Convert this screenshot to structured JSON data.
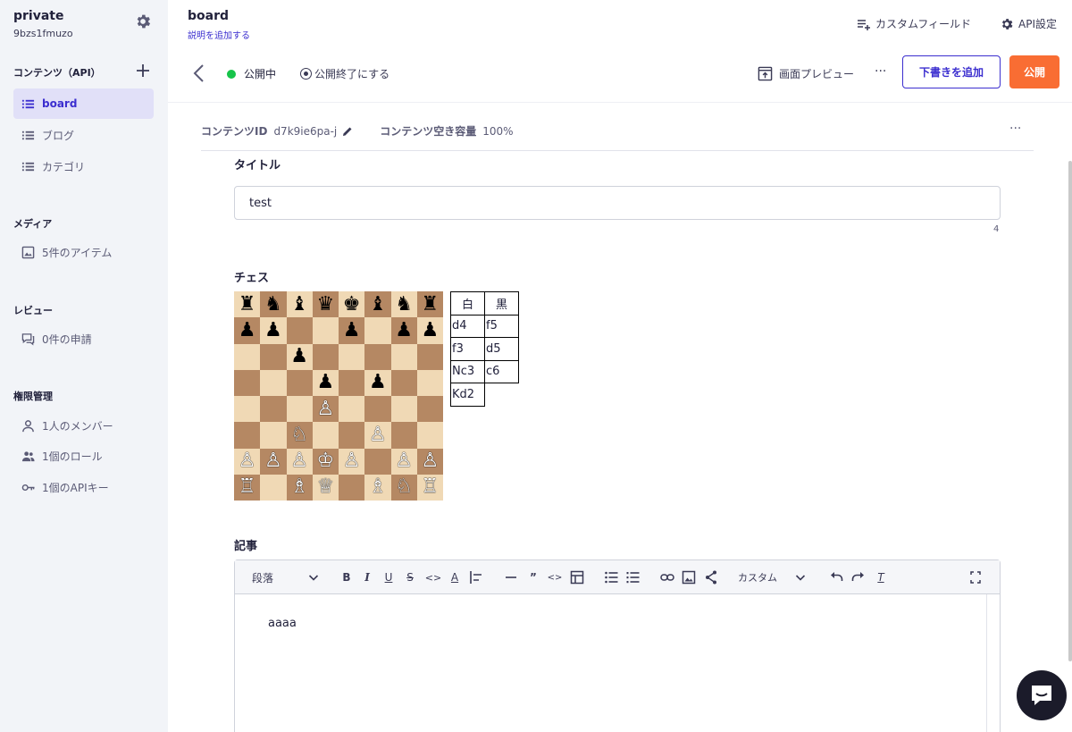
{
  "sidebar": {
    "service_name": "private",
    "service_id": "9bzs1fmuzo",
    "contents_header": "コンテンツ（API）",
    "contents": [
      {
        "label": "board",
        "active": true
      },
      {
        "label": "ブログ",
        "active": false
      },
      {
        "label": "カテゴリ",
        "active": false
      }
    ],
    "media_header": "メディア",
    "media_item": "5件のアイテム",
    "review_header": "レビュー",
    "review_item": "0件の申請",
    "perm_header": "権限管理",
    "perm_items": [
      "1人のメンバー",
      "1個のロール",
      "1個のAPIキー"
    ]
  },
  "header": {
    "title": "board",
    "subtitle": "説明を追加する",
    "custom_field": "カスタムフィールド",
    "api_settings": "API設定"
  },
  "actions": {
    "status": "公開中",
    "status_color": "#17c44a",
    "unpublish": "公開終了にする",
    "preview": "画面プレビュー",
    "more": "···",
    "add_draft": "下書きを追加",
    "publish": "公開",
    "publish_color": "#f96d33",
    "accent_color": "#3b2ecf"
  },
  "meta": {
    "id_label": "コンテンツID",
    "id_value": "d7k9ie6pa-j",
    "capacity_label": "コンテンツ空き容量",
    "capacity_value": "100%",
    "more": "···"
  },
  "fields": {
    "title_label": "タイトル",
    "title_value": "test",
    "title_count": "4",
    "chess_label": "チェス",
    "article_label": "記事"
  },
  "chess": {
    "board": [
      [
        "♜",
        "♞",
        "♝",
        "♛",
        "♚",
        "♝",
        "♞",
        "♜"
      ],
      [
        "♟",
        "♟",
        "",
        "",
        "♟",
        "",
        "♟",
        "♟"
      ],
      [
        "",
        "",
        "♟",
        "",
        "",
        "",
        "",
        ""
      ],
      [
        "",
        "",
        "",
        "♟",
        "",
        "♟",
        "",
        ""
      ],
      [
        "",
        "",
        "",
        "♙",
        "",
        "",
        "",
        ""
      ],
      [
        "",
        "",
        "♘",
        "",
        "",
        "♙",
        "",
        ""
      ],
      [
        "♙",
        "♙",
        "♙",
        "♔",
        "♙",
        "",
        "♙",
        "♙"
      ],
      [
        "♖",
        "",
        "♗",
        "♕",
        "",
        "♗",
        "♘",
        "♖"
      ]
    ],
    "moves_header": [
      "白",
      "黒"
    ],
    "moves": [
      [
        "d4",
        "f5"
      ],
      [
        "f3",
        "d5"
      ],
      [
        "Nc3",
        "c6"
      ],
      [
        "Kd2",
        ""
      ]
    ]
  },
  "editor": {
    "paragraph_select": "段落",
    "custom_select": "カスタム",
    "body_text": "aaaa"
  }
}
